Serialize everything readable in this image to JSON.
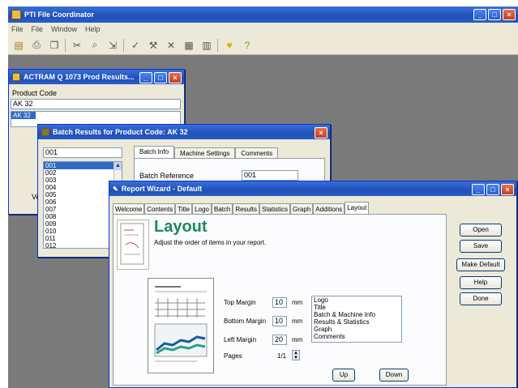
{
  "app": {
    "title": "PTI File Coordinator",
    "menu": [
      "File",
      "File",
      "Window",
      "Help"
    ],
    "toolbar_icons": [
      "open-icon",
      "print-icon",
      "copy-icon",
      "cut-icon",
      "binoculars-icon",
      "export-icon",
      "check-icon",
      "tool-icon",
      "delete-icon",
      "grid-icon",
      "calc-icon",
      "bulb-icon",
      "help-icon"
    ]
  },
  "win_products": {
    "title": "ACTRAM Q 1073 Prod Results...",
    "label_product_code": "Product Code",
    "input_value": "AK 32",
    "list_items": [
      "AK 32"
    ],
    "side_label": "Ve"
  },
  "win_batch": {
    "title": "Batch Results for Product Code: AK 32",
    "search_value": "001",
    "list_items": [
      "001",
      "002",
      "003",
      "004",
      "005",
      "006",
      "007",
      "008",
      "009",
      "010",
      "011",
      "012"
    ],
    "selected_index": 0,
    "tabs": [
      "Batch Info",
      "Machine Settings",
      "Comments"
    ],
    "batch_ref_label": "Batch Reference",
    "batch_ref_value": "001"
  },
  "win_wizard": {
    "title": "Report Wizard - Default",
    "tabs": [
      "Welcome",
      "Contents",
      "Title",
      "Logo",
      "Batch",
      "Results",
      "Statistics",
      "Graph",
      "Additions",
      "Layout"
    ],
    "heading": "Layout",
    "subtext": "Adjust the order of items in your report.",
    "top_margin_label": "Top Margin",
    "top_margin_value": "10",
    "bottom_margin_label": "Bottom Margin",
    "bottom_margin_value": "10",
    "left_margin_label": "Left Margin",
    "left_margin_value": "20",
    "pages_label": "Pages",
    "pages_value": "1/1",
    "unit": "mm",
    "order_items": [
      "Logo",
      "Title",
      "Batch & Machine Info",
      "Results & Statistics",
      "Graph",
      "Comments"
    ],
    "buttons": {
      "open": "Open",
      "save": "Save",
      "make_default": "Make Default",
      "help": "Help",
      "done": "Done",
      "up": "Up",
      "down": "Down"
    }
  }
}
